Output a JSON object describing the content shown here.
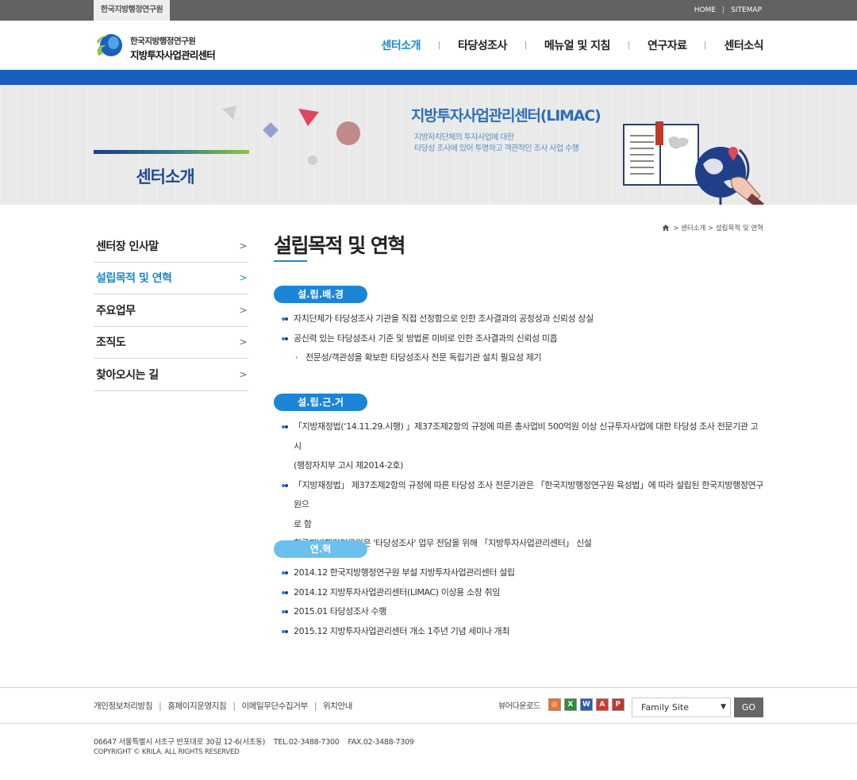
{
  "topbar": {
    "org_tab": "한국지방행정연구원",
    "home": "HOME",
    "sitemap": "SITEMAP"
  },
  "header": {
    "logo_line1": "한국지방행정연구원",
    "logo_line2": "지방투자사업관리센터",
    "gnb": [
      {
        "label": "센터소개",
        "active": true
      },
      {
        "label": "타당성조사",
        "active": false
      },
      {
        "label": "메뉴얼 및 지침",
        "active": false
      },
      {
        "label": "연구자료",
        "active": false
      },
      {
        "label": "센터소식",
        "active": false
      }
    ]
  },
  "banner": {
    "section_title": "센터소개",
    "title": "지방투자사업관리센터(LIMAC)",
    "sub1": "지방자치단체의 투자사업에 대한",
    "sub2": "타당성 조사에 있어 투명하고 객관적인 조사 사업 수행"
  },
  "breadcrumb": {
    "path": "> 센터소개 > 설립목적 및 연혁"
  },
  "lnb": [
    {
      "label": "센터장 인사말",
      "active": false
    },
    {
      "label": "설립목적 및 연혁",
      "active": true
    },
    {
      "label": "주요업무",
      "active": false
    },
    {
      "label": "조직도",
      "active": false
    },
    {
      "label": "찾아오시는 길",
      "active": false
    }
  ],
  "content": {
    "page_title": "설립목적 및 연혁",
    "sections": [
      {
        "heading": "설.립.배.경",
        "items": [
          "자치단체가 타당성조사 기관을 직접 선정함으로 인한 조사결과의 공정성과 신뢰성 상실",
          "공신력 있는 타당성조사 기준 및 방법론 미비로 인한 조사결과의 신뢰성 미흡"
        ],
        "sub_item": "전문성/객관성을 확보한 타당성조사 전문 독립기관 설치 필요성 제기"
      },
      {
        "heading": "설.립.근.거",
        "items": [
          "「지방재정법(‘14.11.29.시행) 」제37조제2항의 규정에 따른 총사업비 500억원 이상 신규투자사업에 대한 타당성 조사 전문기관 고시",
          "(행정자치부 고시 제2014-2호)",
          "「지방재정법」 제37조제2항의 규정에 따른 타당성 조사 전문기관은 「한국지방행정연구원 육성법」에 따라 설립된 한국지방행정연구원으",
          "로 함",
          "한국지방행정연구원은 '타당성조사' 업무 전담을 위해 「지방투자사업관리센터」 신설"
        ]
      },
      {
        "heading": "연.혁",
        "items": [
          "2014.12 한국지방행정연구원 부설 지방투자사업관리센터 설립",
          "2014.12 지방투자사업관리센터(LIMAC) 이상용 소장 취임",
          "2015.01 타당성조사 수행",
          "2015.12 지방투자사업관리센터 개소 1주년 기념 세미나 개최"
        ]
      }
    ]
  },
  "footer": {
    "links": [
      "개인정보처리방침",
      "홈페이지운영지침",
      "이메일무단수집거부",
      "위치안내"
    ],
    "viewer_label": "뷰어다운로드",
    "family_site": "Family Site",
    "go": "GO",
    "address": "06647 서울특별시 서초구 반포대로 30길 12-6(서초동)    TEL.02-3488-7300    FAX.02-3488-7309",
    "copyright": "COPYRIGHT © KRILA. ALL RIGHTS RESERVED"
  },
  "colors": {
    "accent": "#1b8ac9",
    "stripe": "#1a5fbd",
    "pill_dark": "#1b86d8",
    "pill_light": "#6cc0ee"
  }
}
